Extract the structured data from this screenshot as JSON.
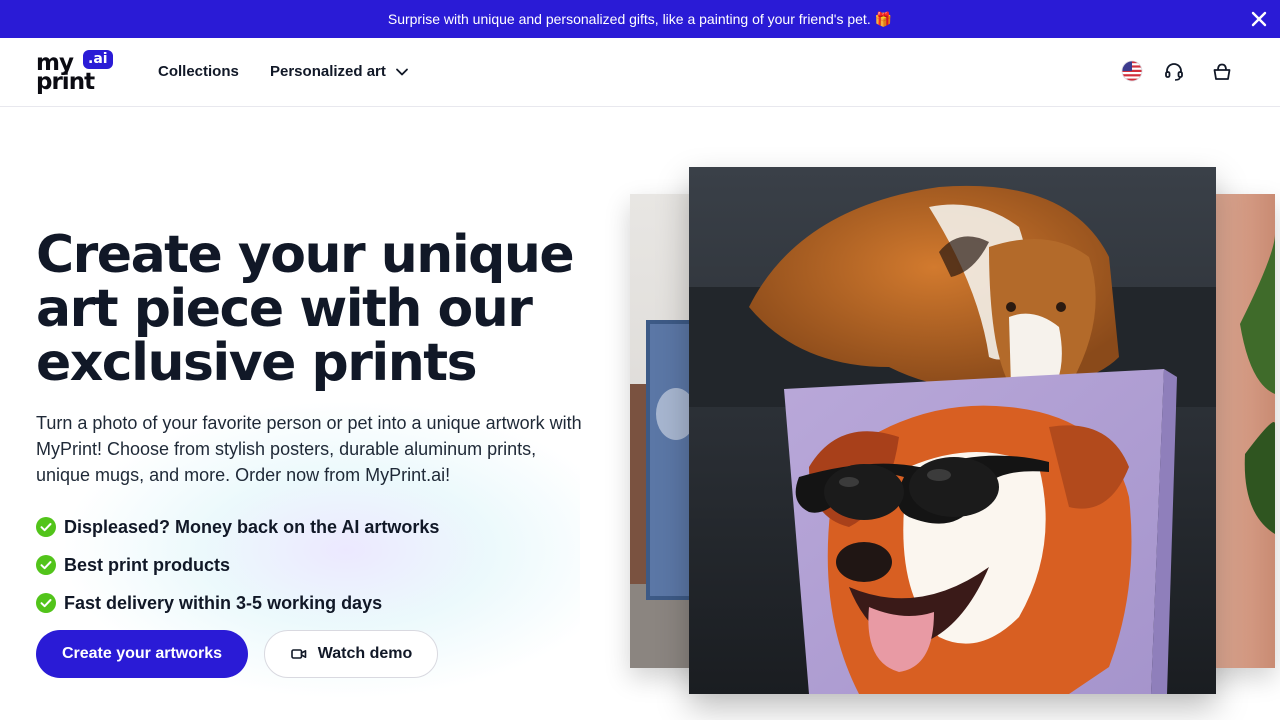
{
  "promo": {
    "text": "Surprise with unique and personalized gifts, like a painting of your friend's pet.",
    "gift_emoji": "🎁"
  },
  "header": {
    "logo": {
      "my": "my",
      "print": "print",
      "ai": ".ai"
    },
    "nav": [
      {
        "label": "Collections"
      },
      {
        "label": "Personalized art"
      }
    ],
    "icons": [
      "us-flag-icon",
      "headset-icon",
      "basket-icon"
    ]
  },
  "hero": {
    "title": "Create your unique art piece with our exclusive prints",
    "subtitle": "Turn a photo of your favorite person or pet into a unique artwork with MyPrint! Choose from stylish posters, durable aluminum prints, unique mugs, and more. Order now from MyPrint.ai!",
    "features": [
      "Displeased? Money back on the AI artworks",
      "Best print products",
      "Fast delivery within 3-5 working days"
    ],
    "primary_button": "Create your artworks",
    "secondary_button": "Watch demo"
  },
  "colors": {
    "brand": "#2a1bd6",
    "check": "#52c41a",
    "text": "#111827"
  }
}
